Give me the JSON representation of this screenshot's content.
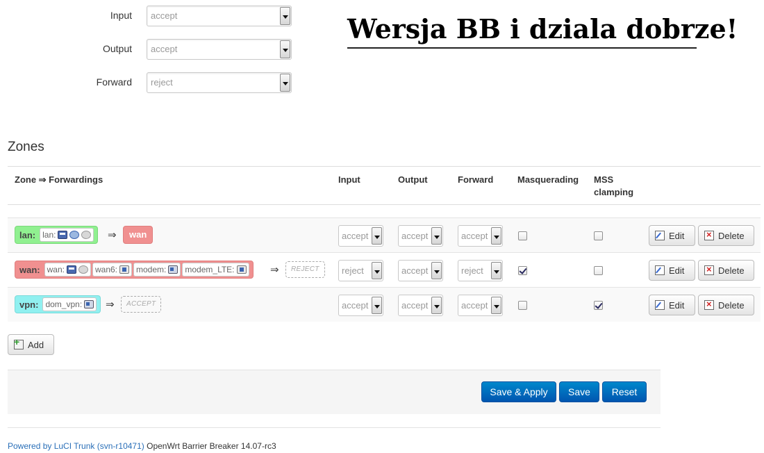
{
  "defaults": {
    "input": {
      "label": "Input",
      "value": "accept"
    },
    "output": {
      "label": "Output",
      "value": "accept"
    },
    "forward": {
      "label": "Forward",
      "value": "reject"
    }
  },
  "banner": "Wersja BB i dziala dobrze!",
  "zones": {
    "title": "Zones",
    "headers": {
      "zone": "Zone ⇒ Forwardings",
      "input": "Input",
      "output": "Output",
      "forward": "Forward",
      "masq": "Masquerading",
      "mss": "MSS clamping"
    },
    "rows": [
      {
        "name": "lan:",
        "color": "#90f090",
        "networks": [
          "lan:"
        ],
        "arrow": "⇒",
        "target": "wan",
        "input": "accept",
        "output": "accept",
        "forward": "accept",
        "masquerading": false,
        "mss_clamping": false,
        "edit_label": "Edit",
        "delete_label": "Delete"
      },
      {
        "name": "wan:",
        "color": "#f09090",
        "networks": [
          "wan:",
          "wan6:",
          "modem:",
          "modem_LTE:"
        ],
        "arrow": "⇒",
        "target": "REJECT",
        "input": "reject",
        "output": "accept",
        "forward": "reject",
        "masquerading": true,
        "mss_clamping": false,
        "edit_label": "Edit",
        "delete_label": "Delete"
      },
      {
        "name": "vpn:",
        "color": "#90f0f0",
        "networks": [
          "dom_vpn:"
        ],
        "arrow": "⇒",
        "target": "ACCEPT",
        "input": "accept",
        "output": "accept",
        "forward": "accept",
        "masquerading": false,
        "mss_clamping": true,
        "edit_label": "Edit",
        "delete_label": "Delete"
      }
    ],
    "add_label": "Add"
  },
  "actions": {
    "save_apply": "Save & Apply",
    "save": "Save",
    "reset": "Reset"
  },
  "footer": {
    "link_text": "Powered by LuCI Trunk (svn-r10471)",
    "version": "OpenWrt Barrier Breaker 14.07-rc3"
  },
  "colors": {
    "primary_button": "#0066cc",
    "link": "#2a6fb8"
  }
}
